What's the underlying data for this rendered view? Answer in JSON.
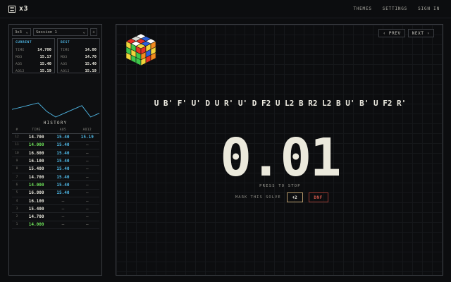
{
  "app": {
    "name": "x3",
    "icon": "grid-logo-icon"
  },
  "nav": {
    "themes": "THEMES",
    "settings": "SETTINGS",
    "sign_in": "SIGN IN"
  },
  "session": {
    "puzzle": "3x3",
    "name": "Session 1",
    "add": "+"
  },
  "current": {
    "title": "CURRENT",
    "rows": [
      {
        "k": "TIME",
        "v": "14.700"
      },
      {
        "k": "MO3",
        "v": "15.17"
      },
      {
        "k": "AO5",
        "v": "15.40"
      },
      {
        "k": "AO12",
        "v": "15.19"
      }
    ]
  },
  "best": {
    "title": "BEST",
    "rows": [
      {
        "k": "TIME",
        "v": "14.00"
      },
      {
        "k": "MO3",
        "v": "14.70"
      },
      {
        "k": "AO5",
        "v": "15.40"
      },
      {
        "k": "AO12",
        "v": "15.19"
      }
    ]
  },
  "trend": [
    15.4,
    15.8,
    16.2,
    16.6,
    15.0,
    14.0,
    14.7,
    15.4,
    16.1,
    14.0,
    14.7
  ],
  "history": {
    "title": "HISTORY",
    "headers": [
      "#",
      "TIME",
      "AO5",
      "AO12"
    ],
    "rows": [
      {
        "n": "12",
        "time": "14.700",
        "pb": false,
        "ao5": "15.40",
        "ao12": "15.19"
      },
      {
        "n": "11",
        "time": "14.000",
        "pb": true,
        "ao5": "15.40",
        "ao12": "—"
      },
      {
        "n": "10",
        "time": "16.800",
        "pb": false,
        "ao5": "15.40",
        "ao12": "—"
      },
      {
        "n": "9",
        "time": "16.100",
        "pb": false,
        "ao5": "15.40",
        "ao12": "—"
      },
      {
        "n": "8",
        "time": "15.400",
        "pb": false,
        "ao5": "15.40",
        "ao12": "—"
      },
      {
        "n": "7",
        "time": "14.700",
        "pb": false,
        "ao5": "15.40",
        "ao12": "—"
      },
      {
        "n": "6",
        "time": "14.000",
        "pb": true,
        "ao5": "15.40",
        "ao12": "—"
      },
      {
        "n": "5",
        "time": "16.800",
        "pb": false,
        "ao5": "15.40",
        "ao12": "—"
      },
      {
        "n": "4",
        "time": "16.100",
        "pb": false,
        "ao5": "—",
        "ao12": "—"
      },
      {
        "n": "3",
        "time": "15.400",
        "pb": false,
        "ao5": "—",
        "ao12": "—"
      },
      {
        "n": "2",
        "time": "14.700",
        "pb": false,
        "ao5": "—",
        "ao12": "—"
      },
      {
        "n": "1",
        "time": "14.000",
        "pb": true,
        "ao5": "—",
        "ao12": "—"
      }
    ]
  },
  "controls": {
    "prev": "‹ PREV",
    "next": "NEXT ›"
  },
  "scramble": "U B' F' U' D U R' U' D F2 U L2 B R2 L2 B U' B' U F2 R'",
  "timer": "0.01",
  "hint": "PRESS TO STOP",
  "mark": {
    "label": "MARK THIS SOLVE",
    "plus2": "+2",
    "dnf": "DNF"
  },
  "colors": {
    "accent_blue": "#4fb8e6",
    "pb_green": "#6fe35a",
    "dnf_red": "#d0574a"
  }
}
